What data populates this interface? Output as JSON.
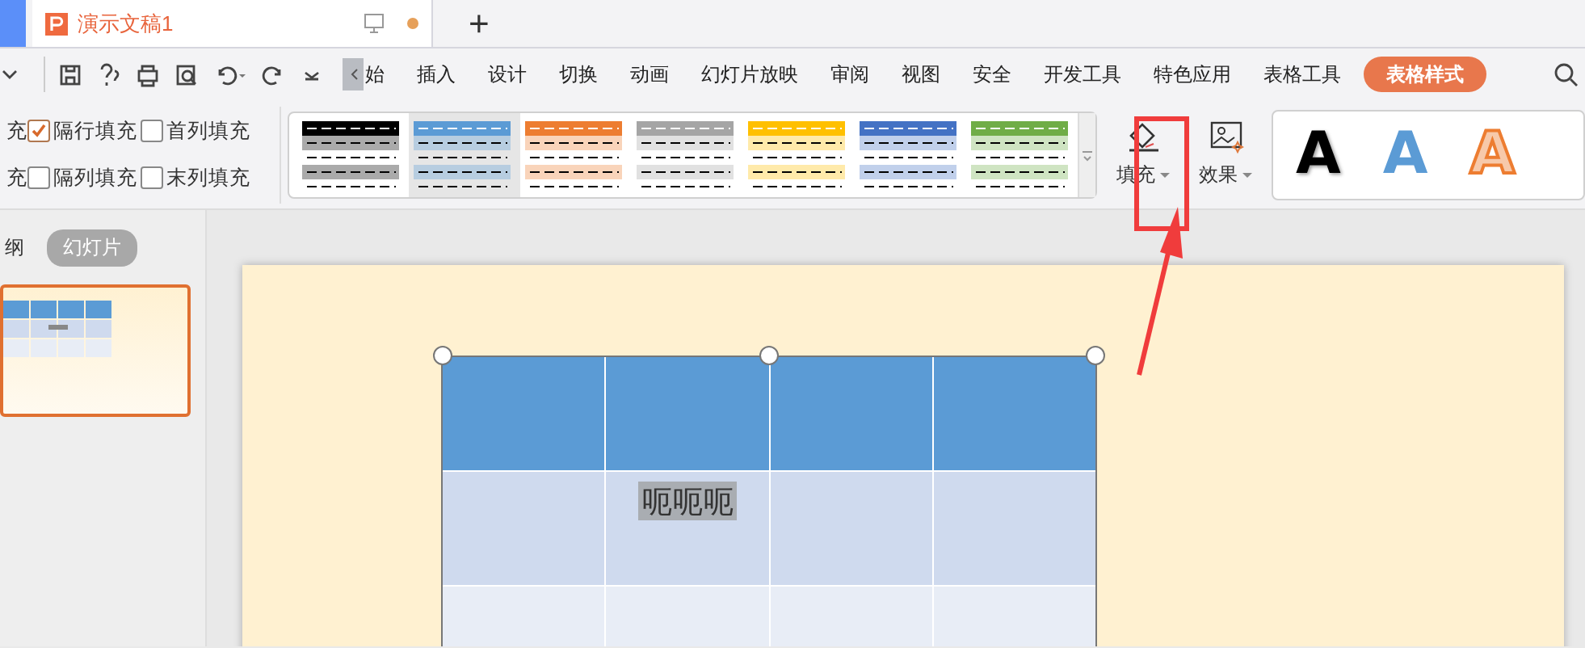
{
  "title_bar": {
    "document_tab": {
      "title": "演示文稿1",
      "unsaved": true
    },
    "new_tab": "+"
  },
  "ribbon_tabs": [
    {
      "label": "始",
      "selected": false
    },
    {
      "label": "插入",
      "selected": false
    },
    {
      "label": "设计",
      "selected": false
    },
    {
      "label": "切换",
      "selected": false
    },
    {
      "label": "动画",
      "selected": false
    },
    {
      "label": "幻灯片放映",
      "selected": false
    },
    {
      "label": "审阅",
      "selected": false
    },
    {
      "label": "视图",
      "selected": false
    },
    {
      "label": "安全",
      "selected": false
    },
    {
      "label": "开发工具",
      "selected": false
    },
    {
      "label": "特色应用",
      "selected": false
    },
    {
      "label": "表格工具",
      "selected": false
    },
    {
      "label": "表格样式",
      "selected": true
    }
  ],
  "options": [
    {
      "label": "充"
    },
    {
      "label": "隔行填充",
      "checked": true
    },
    {
      "label": "首列填充",
      "checked": false
    },
    {
      "label": "充"
    },
    {
      "label": "隔列填充",
      "checked": false
    },
    {
      "label": "末列填充",
      "checked": false
    }
  ],
  "table_styles": [
    {
      "color": "#000000",
      "selected": false
    },
    {
      "color": "#5b9bd5",
      "selected": true
    },
    {
      "color": "#ed7d31",
      "selected": false
    },
    {
      "color": "#a5a5a5",
      "selected": false
    },
    {
      "color": "#ffc000",
      "selected": false
    },
    {
      "color": "#4472c4",
      "selected": false
    },
    {
      "color": "#70ad47",
      "selected": false
    }
  ],
  "fill_button": "填充",
  "effect_button": "效果",
  "text_styles": [
    {
      "label": "A",
      "kind": "shadow"
    },
    {
      "label": "A",
      "kind": "blue"
    },
    {
      "label": "A",
      "kind": "orange-outline"
    }
  ],
  "sidebar": {
    "tabs": [
      {
        "label": "纲",
        "selected": false
      },
      {
        "label": "幻灯片",
        "selected": true
      }
    ],
    "thumbnail": {
      "selected": true
    }
  },
  "slide": {
    "table": {
      "rows": [
        {
          "kind": "header"
        },
        {
          "kind": "band",
          "text": "呃呃呃",
          "text_selected": true
        },
        {
          "kind": "light"
        }
      ]
    }
  }
}
